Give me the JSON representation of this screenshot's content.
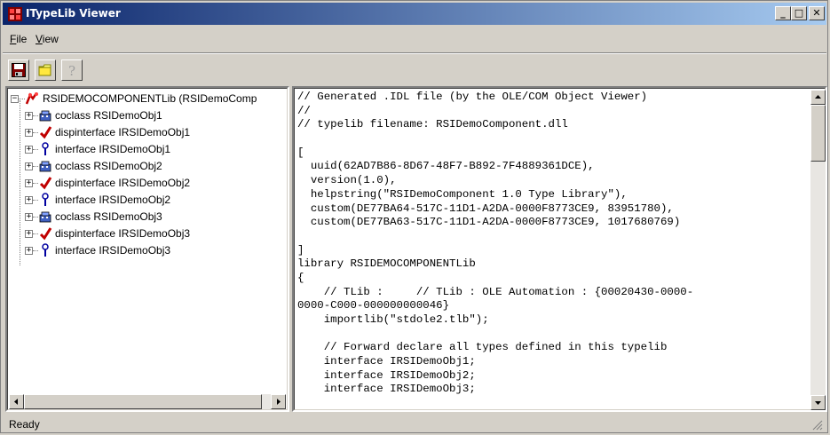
{
  "window": {
    "title": "ITypeLib Viewer",
    "controls": {
      "minimize": "_",
      "maximize": "□",
      "close": "✕"
    }
  },
  "menu": [
    {
      "label": "File",
      "mnemonic": "F",
      "rest": "ile"
    },
    {
      "label": "View",
      "mnemonic": "V",
      "rest": "iew"
    }
  ],
  "toolbar": {
    "buttons": [
      {
        "name": "save-icon"
      },
      {
        "name": "open-folder-icon"
      },
      {
        "name": "help-icon",
        "glyph": "?"
      }
    ]
  },
  "tree": {
    "root": {
      "label": "RSIDEMOCOMPONENTLib (RSIDemoComp",
      "icon": "library-icon",
      "expander": "−"
    },
    "items": [
      {
        "label": "coclass RSIDemoObj1",
        "icon": "coclass-icon",
        "expander": "+"
      },
      {
        "label": "dispinterface IRSIDemoObj1",
        "icon": "dispinterface-icon",
        "expander": "+"
      },
      {
        "label": "interface IRSIDemoObj1",
        "icon": "interface-icon",
        "expander": "+"
      },
      {
        "label": "coclass RSIDemoObj2",
        "icon": "coclass-icon",
        "expander": "+"
      },
      {
        "label": "dispinterface IRSIDemoObj2",
        "icon": "dispinterface-icon",
        "expander": "+"
      },
      {
        "label": "interface IRSIDemoObj2",
        "icon": "interface-icon",
        "expander": "+"
      },
      {
        "label": "coclass RSIDemoObj3",
        "icon": "coclass-icon",
        "expander": "+"
      },
      {
        "label": "dispinterface IRSIDemoObj3",
        "icon": "dispinterface-icon",
        "expander": "+"
      },
      {
        "label": "interface IRSIDemoObj3",
        "icon": "interface-icon",
        "expander": "+"
      }
    ]
  },
  "code": {
    "lines": [
      "// Generated .IDL file (by the OLE/COM Object Viewer)",
      "//",
      "// typelib filename: RSIDemoComponent.dll",
      "",
      "[",
      "  uuid(62AD7B86-8D67-48F7-B892-7F4889361DCE),",
      "  version(1.0),",
      "  helpstring(\"RSIDemoComponent 1.0 Type Library\"),",
      "  custom(DE77BA64-517C-11D1-A2DA-0000F8773CE9, 83951780),",
      "  custom(DE77BA63-517C-11D1-A2DA-0000F8773CE9, 1017680769)",
      "",
      "]",
      "library RSIDEMOCOMPONENTLib",
      "{",
      "    // TLib :     // TLib : OLE Automation : {00020430-0000-",
      "0000-C000-000000000046}",
      "    importlib(\"stdole2.tlb\");",
      "",
      "    // Forward declare all types defined in this typelib",
      "    interface IRSIDemoObj1;",
      "    interface IRSIDemoObj2;",
      "    interface IRSIDemoObj3;"
    ]
  },
  "status": {
    "text": "Ready"
  },
  "colors": {
    "titlebar_start": "#0a246a",
    "titlebar_end": "#a6caf0",
    "face": "#d4d0c8"
  }
}
